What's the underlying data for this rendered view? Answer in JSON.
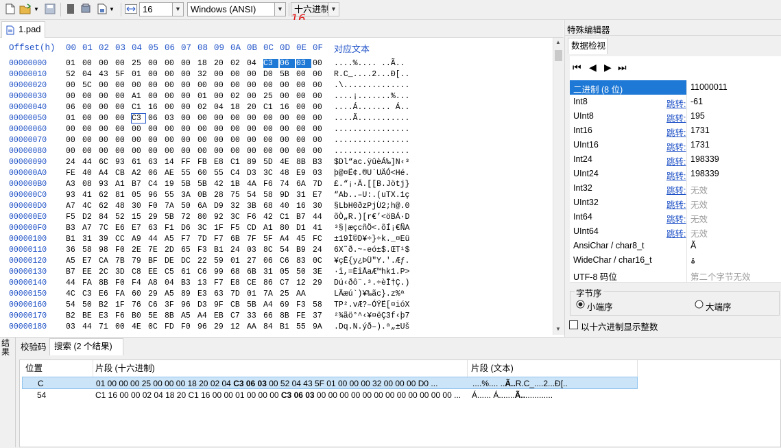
{
  "toolbar": {
    "width_value": "16",
    "encoding_value": "Windows (ANSI)",
    "mode_value": "十六进制",
    "annotation": "16",
    "icons": [
      "new-file-icon",
      "open-folder-icon",
      "save-icon",
      "page-icon",
      "stack-icon",
      "export-icon",
      "width-arrows-icon"
    ]
  },
  "file_tab": {
    "label": "1.pad"
  },
  "hex": {
    "offset_header": "Offset(h)",
    "col_headers": [
      "00",
      "01",
      "02",
      "03",
      "04",
      "05",
      "06",
      "07",
      "08",
      "09",
      "0A",
      "0B",
      "0C",
      "0D",
      "0E",
      "0F"
    ],
    "text_header": "对应文本",
    "rows": [
      {
        "off": "00000000",
        "bytes": [
          "01",
          "00",
          "00",
          "00",
          "25",
          "00",
          "00",
          "00",
          "18",
          "20",
          "02",
          "04",
          "C3",
          "06",
          "03",
          "00"
        ],
        "text": "....%.... ..Ã.."
      },
      {
        "off": "00000010",
        "bytes": [
          "52",
          "04",
          "43",
          "5F",
          "01",
          "00",
          "00",
          "00",
          "32",
          "00",
          "00",
          "00",
          "D0",
          "5B",
          "00",
          "00"
        ],
        "text": "R.C_....2...Ð[.."
      },
      {
        "off": "00000020",
        "bytes": [
          "00",
          "5C",
          "00",
          "00",
          "00",
          "00",
          "00",
          "00",
          "00",
          "00",
          "00",
          "00",
          "00",
          "00",
          "00",
          "00"
        ],
        "text": ".\\.............."
      },
      {
        "off": "00000030",
        "bytes": [
          "00",
          "00",
          "00",
          "00",
          "A1",
          "00",
          "00",
          "00",
          "01",
          "00",
          "02",
          "00",
          "25",
          "00",
          "00",
          "00"
        ],
        "text": "....¡.......%..."
      },
      {
        "off": "00000040",
        "bytes": [
          "06",
          "00",
          "00",
          "00",
          "C1",
          "16",
          "00",
          "00",
          "02",
          "04",
          "18",
          "20",
          "C1",
          "16",
          "00",
          "00"
        ],
        "text": "....Á....... Á.."
      },
      {
        "off": "00000050",
        "bytes": [
          "01",
          "00",
          "00",
          "00",
          "C3",
          "06",
          "03",
          "00",
          "00",
          "00",
          "00",
          "00",
          "00",
          "00",
          "00",
          "00"
        ],
        "text": "....Ã..........."
      },
      {
        "off": "00000060",
        "bytes": [
          "00",
          "00",
          "00",
          "00",
          "00",
          "00",
          "00",
          "00",
          "00",
          "00",
          "00",
          "00",
          "00",
          "00",
          "00",
          "00"
        ],
        "text": "................"
      },
      {
        "off": "00000070",
        "bytes": [
          "00",
          "00",
          "00",
          "00",
          "00",
          "00",
          "00",
          "00",
          "00",
          "00",
          "00",
          "00",
          "00",
          "00",
          "00",
          "00"
        ],
        "text": "................"
      },
      {
        "off": "00000080",
        "bytes": [
          "00",
          "00",
          "00",
          "00",
          "00",
          "00",
          "00",
          "00",
          "00",
          "00",
          "00",
          "00",
          "00",
          "00",
          "00",
          "00"
        ],
        "text": "................"
      },
      {
        "off": "00000090",
        "bytes": [
          "24",
          "44",
          "6C",
          "93",
          "61",
          "63",
          "14",
          "FF",
          "FB",
          "E8",
          "C1",
          "89",
          "5D",
          "4E",
          "8B",
          "B3"
        ],
        "text": "$Dl“ac.ÿûèÁ‰]N‹³"
      },
      {
        "off": "000000A0",
        "bytes": [
          "FE",
          "40",
          "A4",
          "CB",
          "A2",
          "06",
          "AE",
          "55",
          "60",
          "55",
          "C4",
          "D3",
          "3C",
          "48",
          "E9",
          "03"
        ],
        "text": "þ@¤Ë¢.®U`UÄÓ<Hé."
      },
      {
        "off": "000000B0",
        "bytes": [
          "A3",
          "08",
          "93",
          "A1",
          "B7",
          "C4",
          "19",
          "5B",
          "5B",
          "42",
          "1B",
          "4A",
          "F6",
          "74",
          "6A",
          "7D"
        ],
        "text": "£.“¡·Ä.[[B.Jötj}"
      },
      {
        "off": "000000C0",
        "bytes": [
          "93",
          "41",
          "62",
          "81",
          "05",
          "96",
          "55",
          "3A",
          "0B",
          "28",
          "75",
          "54",
          "58",
          "9D",
          "31",
          "E7"
        ],
        "text": "“Ab..–U:.(uTX.1ç"
      },
      {
        "off": "000000D0",
        "bytes": [
          "A7",
          "4C",
          "62",
          "48",
          "30",
          "F0",
          "7A",
          "50",
          "6A",
          "D9",
          "32",
          "3B",
          "68",
          "40",
          "16",
          "30"
        ],
        "text": "§LbH0ðzPjÙ2;h@.0"
      },
      {
        "off": "000000E0",
        "bytes": [
          "F5",
          "D2",
          "84",
          "52",
          "15",
          "29",
          "5B",
          "72",
          "80",
          "92",
          "3C",
          "F6",
          "42",
          "C1",
          "B7",
          "44"
        ],
        "text": "õÒ„R.)[r€’<öBÁ·D"
      },
      {
        "off": "000000F0",
        "bytes": [
          "B3",
          "A7",
          "7C",
          "E6",
          "E7",
          "63",
          "F1",
          "D6",
          "3C",
          "1F",
          "F5",
          "CD",
          "A1",
          "80",
          "D1",
          "41"
        ],
        "text": "³§|æçcñÖ<.õÍ¡€ÑA"
      },
      {
        "off": "00000100",
        "bytes": [
          "B1",
          "31",
          "39",
          "CC",
          "A9",
          "44",
          "A5",
          "F7",
          "7D",
          "F7",
          "6B",
          "7F",
          "5F",
          "A4",
          "45",
          "FC"
        ],
        "text": "±19Ì©D¥÷}÷k._¤Eü"
      },
      {
        "off": "00000110",
        "bytes": [
          "36",
          "58",
          "98",
          "F0",
          "2E",
          "7E",
          "2D",
          "65",
          "F3",
          "B1",
          "24",
          "03",
          "8C",
          "54",
          "B9",
          "24"
        ],
        "text": "6X˜ð.~-eó±$.ŒT¹$"
      },
      {
        "off": "00000120",
        "bytes": [
          "A5",
          "E7",
          "CA",
          "7B",
          "79",
          "BF",
          "DE",
          "DC",
          "22",
          "59",
          "01",
          "27",
          "06",
          "C6",
          "83",
          "0C"
        ],
        "text": "¥çÊ{y¿ÞÜ\"Y.'.Æƒ."
      },
      {
        "off": "00000130",
        "bytes": [
          "B7",
          "EE",
          "2C",
          "3D",
          "C8",
          "EE",
          "C5",
          "61",
          "C6",
          "99",
          "68",
          "6B",
          "31",
          "05",
          "50",
          "3E"
        ],
        "text": "·î,=ÈîÅaÆ™hk1.P>"
      },
      {
        "off": "00000140",
        "bytes": [
          "44",
          "FA",
          "8B",
          "F0",
          "F4",
          "A8",
          "04",
          "B3",
          "13",
          "F7",
          "E8",
          "CE",
          "86",
          "C7",
          "12",
          "29"
        ],
        "text": "Dú‹ðô¨.³.÷èÎ†Ç.)"
      },
      {
        "off": "00000150",
        "bytes": [
          "4C",
          "C3",
          "E6",
          "FA",
          "60",
          "29",
          "A5",
          "89",
          "E3",
          "63",
          "7D",
          "01",
          "7A",
          "25",
          "AA"
        ],
        "text": "LÃæú`)¥‰ãc}.z%ª"
      },
      {
        "off": "00000160",
        "bytes": [
          "54",
          "50",
          "B2",
          "1F",
          "76",
          "C6",
          "3F",
          "96",
          "D3",
          "9F",
          "CB",
          "5B",
          "A4",
          "69",
          "F3",
          "58"
        ],
        "text": "TP².vÆ?–ÓŸË[¤ióX"
      },
      {
        "off": "00000170",
        "bytes": [
          "B2",
          "BE",
          "E3",
          "F6",
          "B0",
          "5E",
          "8B",
          "A5",
          "A4",
          "EB",
          "C7",
          "33",
          "66",
          "8B",
          "FE",
          "37"
        ],
        "text": "²¾ãö°^‹¥¤ëÇ3f‹þ7"
      },
      {
        "off": "00000180",
        "bytes": [
          "03",
          "44",
          "71",
          "00",
          "4E",
          "0C",
          "FD",
          "F0",
          "96",
          "29",
          "12",
          "AA",
          "84",
          "B1",
          "55",
          "9A"
        ],
        "text": ".Dq.N.ýð–).ª„±Uš"
      }
    ]
  },
  "panel": {
    "title": "特殊编辑器",
    "tab": "数据检视",
    "jump_label": "跳转:",
    "items": [
      {
        "key": "二进制 (8 位)",
        "value": "11000011",
        "jump": false,
        "selected": true,
        "grey": false
      },
      {
        "key": "Int8",
        "value": "-61",
        "jump": true,
        "grey": false
      },
      {
        "key": "UInt8",
        "value": "195",
        "jump": true,
        "grey": false
      },
      {
        "key": "Int16",
        "value": "1731",
        "jump": true,
        "grey": false
      },
      {
        "key": "UInt16",
        "value": "1731",
        "jump": true,
        "grey": false
      },
      {
        "key": "Int24",
        "value": "198339",
        "jump": true,
        "grey": false
      },
      {
        "key": "UInt24",
        "value": "198339",
        "jump": true,
        "grey": false
      },
      {
        "key": "Int32",
        "value": "无效",
        "jump": true,
        "grey": true
      },
      {
        "key": "UInt32",
        "value": "无效",
        "jump": true,
        "grey": true
      },
      {
        "key": "Int64",
        "value": "无效",
        "jump": true,
        "grey": true
      },
      {
        "key": "UInt64",
        "value": "无效",
        "jump": true,
        "grey": true
      },
      {
        "key": "AnsiChar / char8_t",
        "value": "Ã",
        "jump": false,
        "grey": false
      },
      {
        "key": "WideChar / char16_t",
        "value": "ۃ",
        "jump": false,
        "grey": false
      },
      {
        "key": "UTF-8 码位",
        "value": "第二个字节无效",
        "jump": false,
        "grey": true
      }
    ],
    "byte_order_label": "字节序",
    "little_endian": "小端序",
    "big_endian": "大端序",
    "hex_int_label": "以十六进制显示整数"
  },
  "bottom": {
    "side_label": "结果",
    "tabs": [
      "校验码",
      "搜索 (2 个结果)"
    ],
    "columns": [
      "位置",
      "片段 (十六进制)",
      "片段 (文本)"
    ],
    "results": [
      {
        "pos": "C",
        "hex_pre": "01 00 00 00 25 00 00 00 18 20 02 04 ",
        "hex_hit": "C3 06 03",
        "hex_post": " 00 52 04 43 5F 01 00 00 00 32 00 00 00 D0 ...",
        "text_pre": "....%.... ..",
        "text_hit": "Ã..",
        "text_post": "R.C_....2...Ð[.."
      },
      {
        "pos": "54",
        "hex_pre": "C1 16 00 00 02 04 18 20 C1 16 00 00 01 00 00 00 ",
        "hex_hit": "C3 06 03",
        "hex_post": " 00 00 00 00 00 00 00 00 00 00 00 00 ...",
        "text_pre": "Á...... Á.......",
        "text_hit": "Ã..",
        "text_post": "............"
      }
    ]
  }
}
